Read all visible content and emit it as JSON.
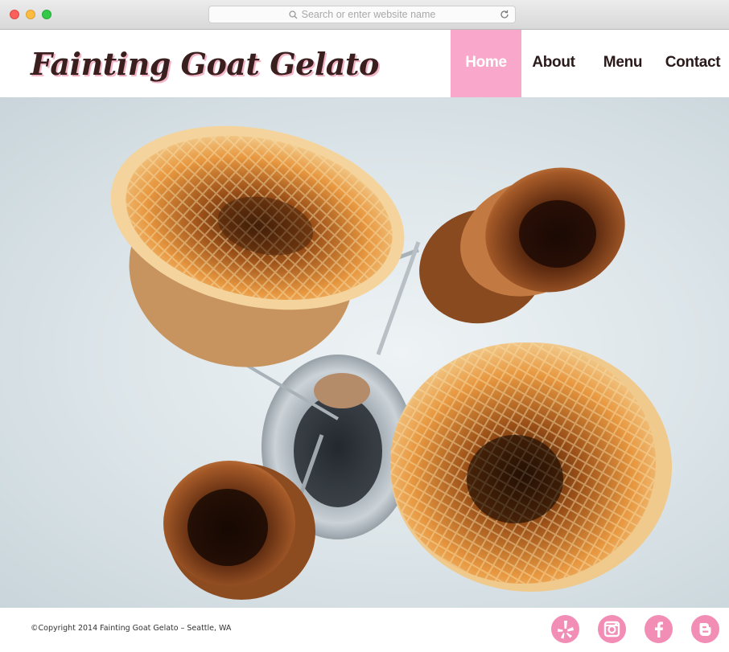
{
  "browser": {
    "url_placeholder": "Search or enter website name"
  },
  "site": {
    "logo": "Fainting Goat Gelato",
    "nav": [
      {
        "label": "Home",
        "active": true
      },
      {
        "label": "About",
        "active": false
      },
      {
        "label": "Menu",
        "active": false
      },
      {
        "label": "Contact",
        "active": false
      }
    ]
  },
  "hero": {
    "image": "waffle-cones-on-stand-photo"
  },
  "footer": {
    "copyright": "©Copyright 2014 Fainting Goat Gelato – Seattle, WA",
    "social": [
      "yelp-icon",
      "instagram-icon",
      "facebook-icon",
      "blogger-icon"
    ]
  },
  "colors": {
    "accent_pink": "#f9a8cb",
    "social_pink": "#f28db5",
    "logo_brown": "#3a1f1f"
  }
}
